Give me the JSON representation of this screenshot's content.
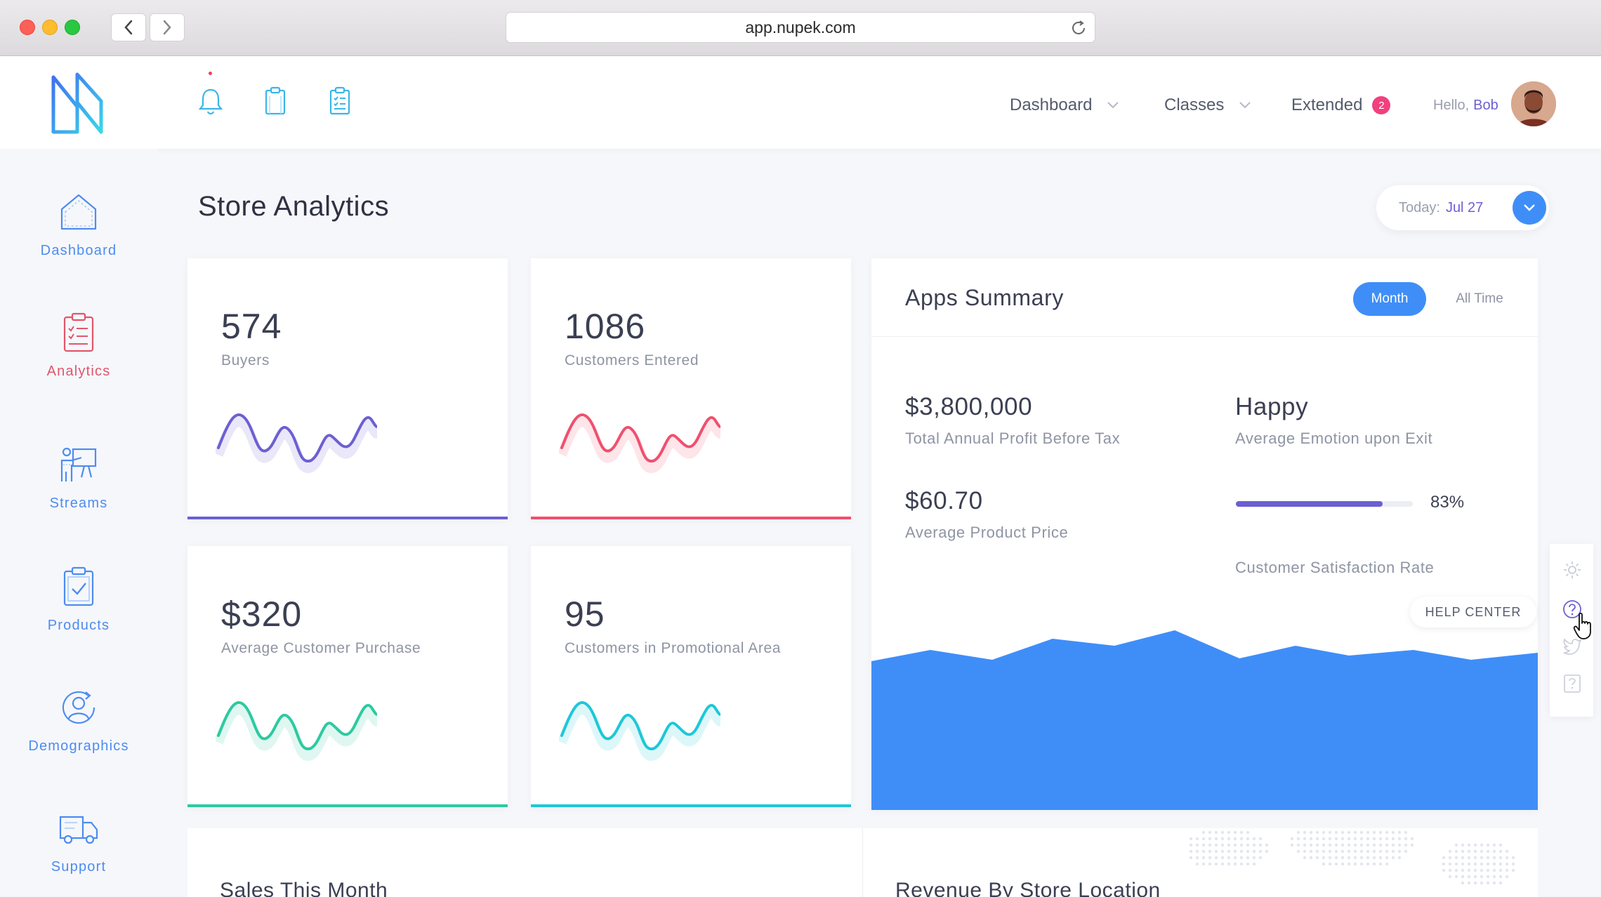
{
  "browser": {
    "url": "app.nupek.com"
  },
  "header": {
    "nav": [
      {
        "label": "Dashboard"
      },
      {
        "label": "Classes"
      },
      {
        "label": "Extended",
        "badge": "2"
      }
    ],
    "greeting": "Hello,",
    "user": "Bob"
  },
  "sidebar": {
    "items": [
      {
        "label": "Dashboard",
        "icon": "house-icon"
      },
      {
        "label": "Analytics",
        "icon": "clipboard-checklist-icon",
        "active": true
      },
      {
        "label": "Streams",
        "icon": "presentation-icon"
      },
      {
        "label": "Products",
        "icon": "clipboard-check-icon"
      },
      {
        "label": "Demographics",
        "icon": "user-refresh-icon"
      },
      {
        "label": "Support",
        "icon": "truck-icon"
      }
    ]
  },
  "page": {
    "title": "Store Analytics",
    "date_label": "Today:",
    "date_value": "Jul 27"
  },
  "stats": [
    {
      "value": "574",
      "caption": "Buyers",
      "color": "#6c5fd3"
    },
    {
      "value": "1086",
      "caption": "Customers Entered",
      "color": "#f0506e"
    },
    {
      "value": "$320",
      "caption": "Average Customer Purchase",
      "color": "#2ccaa0"
    },
    {
      "value": "95",
      "caption": "Customers in Promotional Area",
      "color": "#1cc8d8"
    }
  ],
  "apps_summary": {
    "title": "Apps Summary",
    "toggle": {
      "active": "Month",
      "other": "All Time"
    },
    "metrics": [
      {
        "value": "$3,800,000",
        "label": "Total Annual Profit Before Tax"
      },
      {
        "value": "Happy",
        "label": "Average Emotion upon Exit"
      },
      {
        "value": "$60.70",
        "label": "Average Product Price"
      },
      {
        "value": "83%",
        "label": "Customer Satisfaction Rate",
        "progress": 0.83
      }
    ]
  },
  "help": {
    "label": "HELP CENTER"
  },
  "bottom": {
    "left_title": "Sales This Month",
    "right_title": "Revenue By Store Location"
  },
  "colors": {
    "accent": "#3f8ef8",
    "purple": "#6c5fd3",
    "active_nav": "#e0566b"
  }
}
